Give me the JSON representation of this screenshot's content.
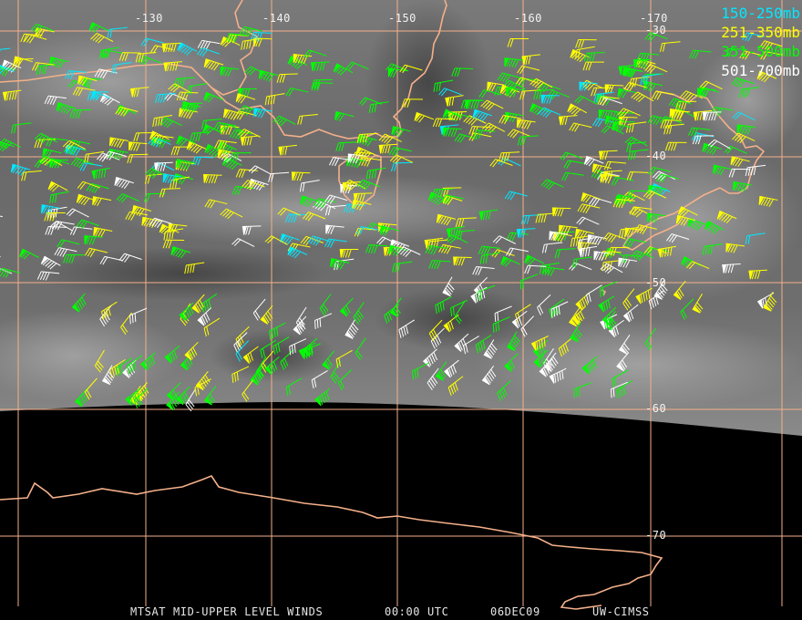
{
  "map": {
    "grid_color": "#f4b08a",
    "coast_color": "#f4b08a",
    "longitude_labels": [
      "-130",
      "-140",
      "-150",
      "-160",
      "-170"
    ],
    "latitude_labels": [
      "-30",
      "-40",
      "-50",
      "-60",
      "-70"
    ]
  },
  "legend": [
    {
      "label": "150-250mb",
      "color": "#00e8ff"
    },
    {
      "label": "251-350mb",
      "color": "#ffff00"
    },
    {
      "label": "351-500mb",
      "color": "#00ff00"
    },
    {
      "label": "501-700mb",
      "color": "#ffffff"
    }
  ],
  "footer": {
    "product": "MTSAT MID-UPPER LEVEL WINDS",
    "time": "00:00 UTC",
    "date": "06DEC09",
    "source": "UW-CIMSS"
  }
}
